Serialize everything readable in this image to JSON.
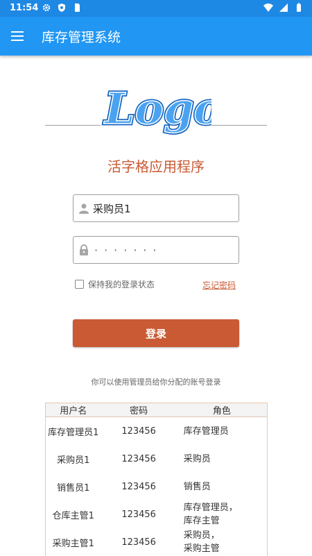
{
  "status_bar": {
    "time": "11:54",
    "left_icons": [
      "gear-icon",
      "shield-icon",
      "sim-icon"
    ],
    "right_icons": [
      "wifi-icon",
      "signal-icon",
      "battery-icon"
    ]
  },
  "app_bar": {
    "title": "库存管理系统",
    "menu_icon": "menu-icon",
    "color": "#2196f3"
  },
  "logo": {
    "text": "Logo",
    "color": "#2f8fe0"
  },
  "app_name": "活字格应用程序",
  "form": {
    "username_value": "采购员1",
    "password_masked": "·······",
    "remember_label": "保持我的登录状态",
    "remember_checked": false,
    "forgot_label": "忘记密码",
    "login_label": "登录",
    "accent_color": "#c95a34"
  },
  "hint": "你可以使用管理员给你分配的账号登录",
  "accounts": {
    "headers": [
      "用户名",
      "密码",
      "角色"
    ],
    "rows": [
      {
        "user": "库存管理员1",
        "password": "123456",
        "role": [
          "库存管理员"
        ]
      },
      {
        "user": "采购员1",
        "password": "123456",
        "role": [
          "采购员"
        ]
      },
      {
        "user": "销售员1",
        "password": "123456",
        "role": [
          "销售员"
        ]
      },
      {
        "user": "仓库主管1",
        "password": "123456",
        "role": [
          "库存管理员，",
          "库存主管"
        ]
      },
      {
        "user": "采购主管1",
        "password": "123456",
        "role": [
          "采购员，",
          "采购主管"
        ]
      }
    ]
  }
}
